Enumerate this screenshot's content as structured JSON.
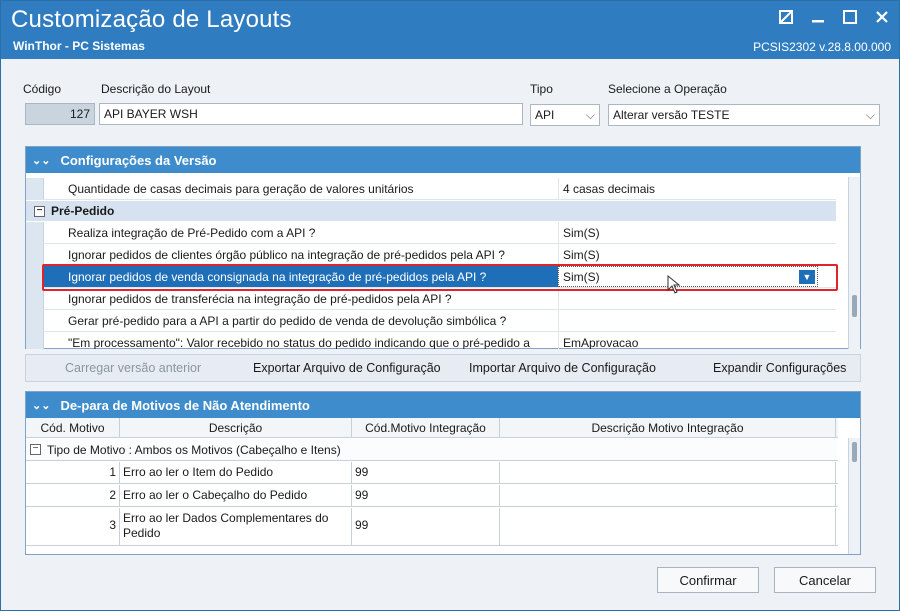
{
  "window": {
    "title": "Customização de Layouts",
    "subtitle": "WinThor - PC Sistemas",
    "version": "PCSIS2302  v.28.8.00.000"
  },
  "form": {
    "codigo_label": "Código",
    "codigo_value": "127",
    "descricao_label": "Descrição do Layout",
    "descricao_value": "API BAYER WSH",
    "tipo_label": "Tipo",
    "tipo_value": "API",
    "operacao_label": "Selecione a Operação",
    "operacao_value": "Alterar versão TESTE"
  },
  "config_panel": {
    "title": "Configurações da Versão",
    "rows": [
      {
        "label": "Quantidade de casas decimais para geração de valores unitários",
        "value": "4 casas decimais"
      }
    ],
    "section_title": "Pré-Pedido",
    "section_rows": [
      {
        "label": "Realiza integração de Pré-Pedido com a API ?",
        "value": "Sim(S)"
      },
      {
        "label": "Ignorar pedidos de clientes órgão público na integração de pré-pedidos pela API ?",
        "value": "Sim(S)"
      },
      {
        "label": "Ignorar pedidos de venda consignada na integração de pré-pedidos pela API ?",
        "value": "Sim(S)"
      },
      {
        "label": "Ignorar pedidos de transferécia na integração de pré-pedidos pela API ?",
        "value": ""
      },
      {
        "label": "Gerar pré-pedido para a API a partir do pedido de venda de devolução simbólica ?",
        "value": ""
      },
      {
        "label": "\"Em processamento\": Valor recebido no status do pedido indicando que o pré-pedido a",
        "value": "EmAprovacao"
      }
    ],
    "toolbar": {
      "carregar": "Carregar versão anterior",
      "exportar": "Exportar Arquivo de Configuração",
      "importar": "Importar Arquivo de Configuração",
      "expandir": "Expandir Configurações"
    }
  },
  "depara_panel": {
    "title": "De-para de Motivos de Não Atendimento",
    "columns": [
      "Cód. Motivo",
      "Descrição",
      "Cód.Motivo Integração",
      "Descrição Motivo Integração"
    ],
    "group_label": "Tipo de Motivo : Ambos os Motivos (Cabeçalho e Itens)",
    "rows": [
      {
        "cod": "1",
        "descricao": "Erro ao ler o Item do Pedido",
        "cod_int": "99",
        "desc_int": ""
      },
      {
        "cod": "2",
        "descricao": "Erro ao ler o Cabeçalho do Pedido",
        "cod_int": "99",
        "desc_int": ""
      },
      {
        "cod": "3",
        "descricao": "Erro ao ler Dados Complementares do Pedido",
        "cod_int": "99",
        "desc_int": ""
      }
    ]
  },
  "buttons": {
    "confirmar": "Confirmar",
    "cancelar": "Cancelar"
  }
}
